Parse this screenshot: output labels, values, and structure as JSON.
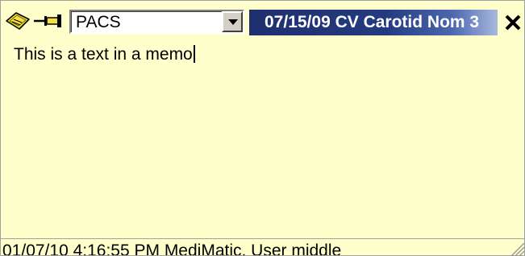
{
  "memo": {
    "note_icon": "note-icon",
    "pin_icon": "pin-icon",
    "category": {
      "selected": "PACS",
      "dropdown_icon": "chevron-down-icon"
    },
    "title": "07/15/09 CV Carotid Nom 3",
    "close_icon": "close-icon",
    "body_text": "This is a text in a memo",
    "footer": "01/07/10 4:16:55 PM MediMatic, User middle",
    "resize_icon": "resize-grip-icon",
    "colors": {
      "background": "#ffffcc",
      "title_bar": "#243a80",
      "title_text": "#ffffff",
      "note_icon": "#f2e040"
    }
  }
}
